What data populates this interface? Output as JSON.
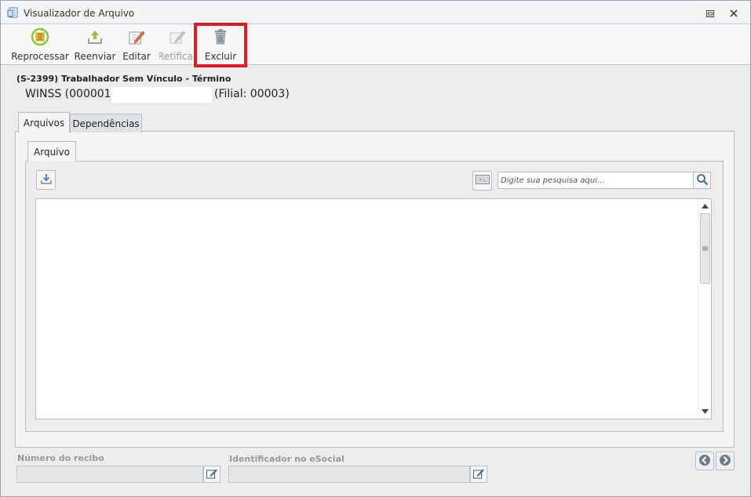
{
  "window": {
    "title": "Visualizador de Arquivo"
  },
  "toolbar": {
    "reprocessar": "Reprocessar",
    "reenviar": "Reenviar",
    "editar": "Editar",
    "retificar": "Retificar",
    "excluir": "Excluir"
  },
  "event": {
    "title": "(S-2399) Trabalhador Sem Vínculo - Término",
    "company": "WINSS (000001)",
    "filial": "(Filial: 00003)"
  },
  "tabs": {
    "arquivos": "Arquivos",
    "dependencias": "Dependências",
    "arquivo": "Arquivo"
  },
  "search": {
    "placeholder": "Digite sua pesquisa aqui..."
  },
  "footer": {
    "numero_recibo_label": "Número do recibo",
    "identificador_label": "Identificador no eSocial"
  },
  "colors": {
    "highlight": "#e01b24",
    "accent_green": "#8cc63f",
    "icon_gray": "#7a8591"
  }
}
